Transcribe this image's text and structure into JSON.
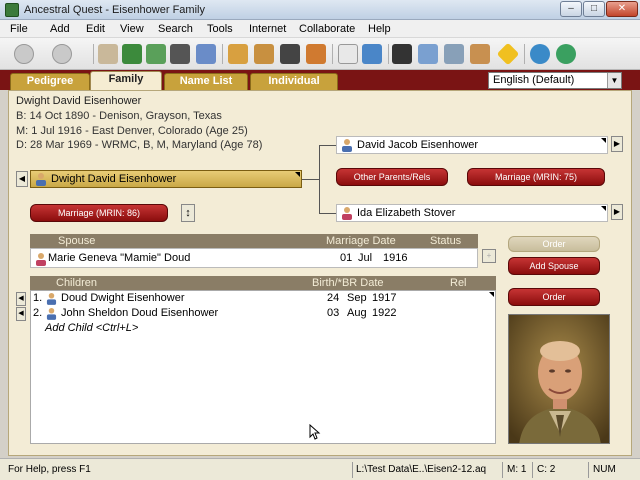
{
  "window": {
    "title": "Ancestral Quest - Eisenhower Family",
    "min": "–",
    "max": "□",
    "close": "✕"
  },
  "menu": [
    "File",
    "Add",
    "Edit",
    "View",
    "Search",
    "Tools",
    "Internet",
    "Collaborate",
    "Help"
  ],
  "toolbar_icons": [
    "back-icon",
    "forward-icon",
    "import-icon",
    "export-icon",
    "print-icon",
    "pedigree-print-icon",
    "individual-icon",
    "edit-icon",
    "camera-icon",
    "add-person-icon",
    "notes-icon",
    "sources-icon",
    "binoculars-icon",
    "calendar-icon",
    "tree-icon",
    "home-icon",
    "caution-icon",
    "internet-icon",
    "globe-icon"
  ],
  "tabs": [
    "Pedigree",
    "Family",
    "Name List",
    "Individual"
  ],
  "active_tab": "Family",
  "language": "English (Default)",
  "person": {
    "name": "Dwight David Eisenhower",
    "birth": "B: 14 Oct 1890 - Denison, Grayson, Texas",
    "marriage": "M: 1 Jul 1916 - East Denver, Colorado (Age 25)",
    "death": "D: 28 Mar 1969 - WRMC, B, M, Maryland (Age 78)"
  },
  "father": "David Jacob Eisenhower",
  "mother": "Ida Elizabeth Stover",
  "buttons": {
    "other_parents": "Other Parents/Rels",
    "parents_marriage": "Marriage (MRIN: 75)",
    "marriage": "Marriage (MRIN: 86)",
    "order_top": "Order",
    "add_spouse": "Add Spouse",
    "order_children": "Order"
  },
  "spouse_table": {
    "headers": {
      "spouse": "Spouse",
      "marriage_date": "Marriage Date",
      "status": "Status"
    },
    "row": {
      "name": "Marie Geneva \"Mamie\" Doud",
      "day": "01",
      "month": "Jul",
      "year": "1916"
    }
  },
  "children_table": {
    "headers": {
      "children": "Children",
      "birth": "Birth/*BR Date",
      "rel": "Rel"
    },
    "rows": [
      {
        "num": "1.",
        "name": "Doud Dwight Eisenhower",
        "day": "24",
        "month": "Sep",
        "year": "1917"
      },
      {
        "num": "2.",
        "name": "John Sheldon Doud Eisenhower",
        "day": "03",
        "month": "Aug",
        "year": "1922"
      }
    ],
    "add_child": "Add Child <Ctrl+L>"
  },
  "statusbar": {
    "help": "For Help, press F1",
    "path": "L:\\Test Data\\E..\\Eisen2-12.aq",
    "m": "M: 1",
    "c": "C: 2",
    "num": "NUM"
  },
  "colors": {
    "brand_red": "#7a1414",
    "tab_gold": "#c8a23c",
    "panel_bg": "#f3ecd6",
    "selected_gold": "#d8b85a"
  }
}
